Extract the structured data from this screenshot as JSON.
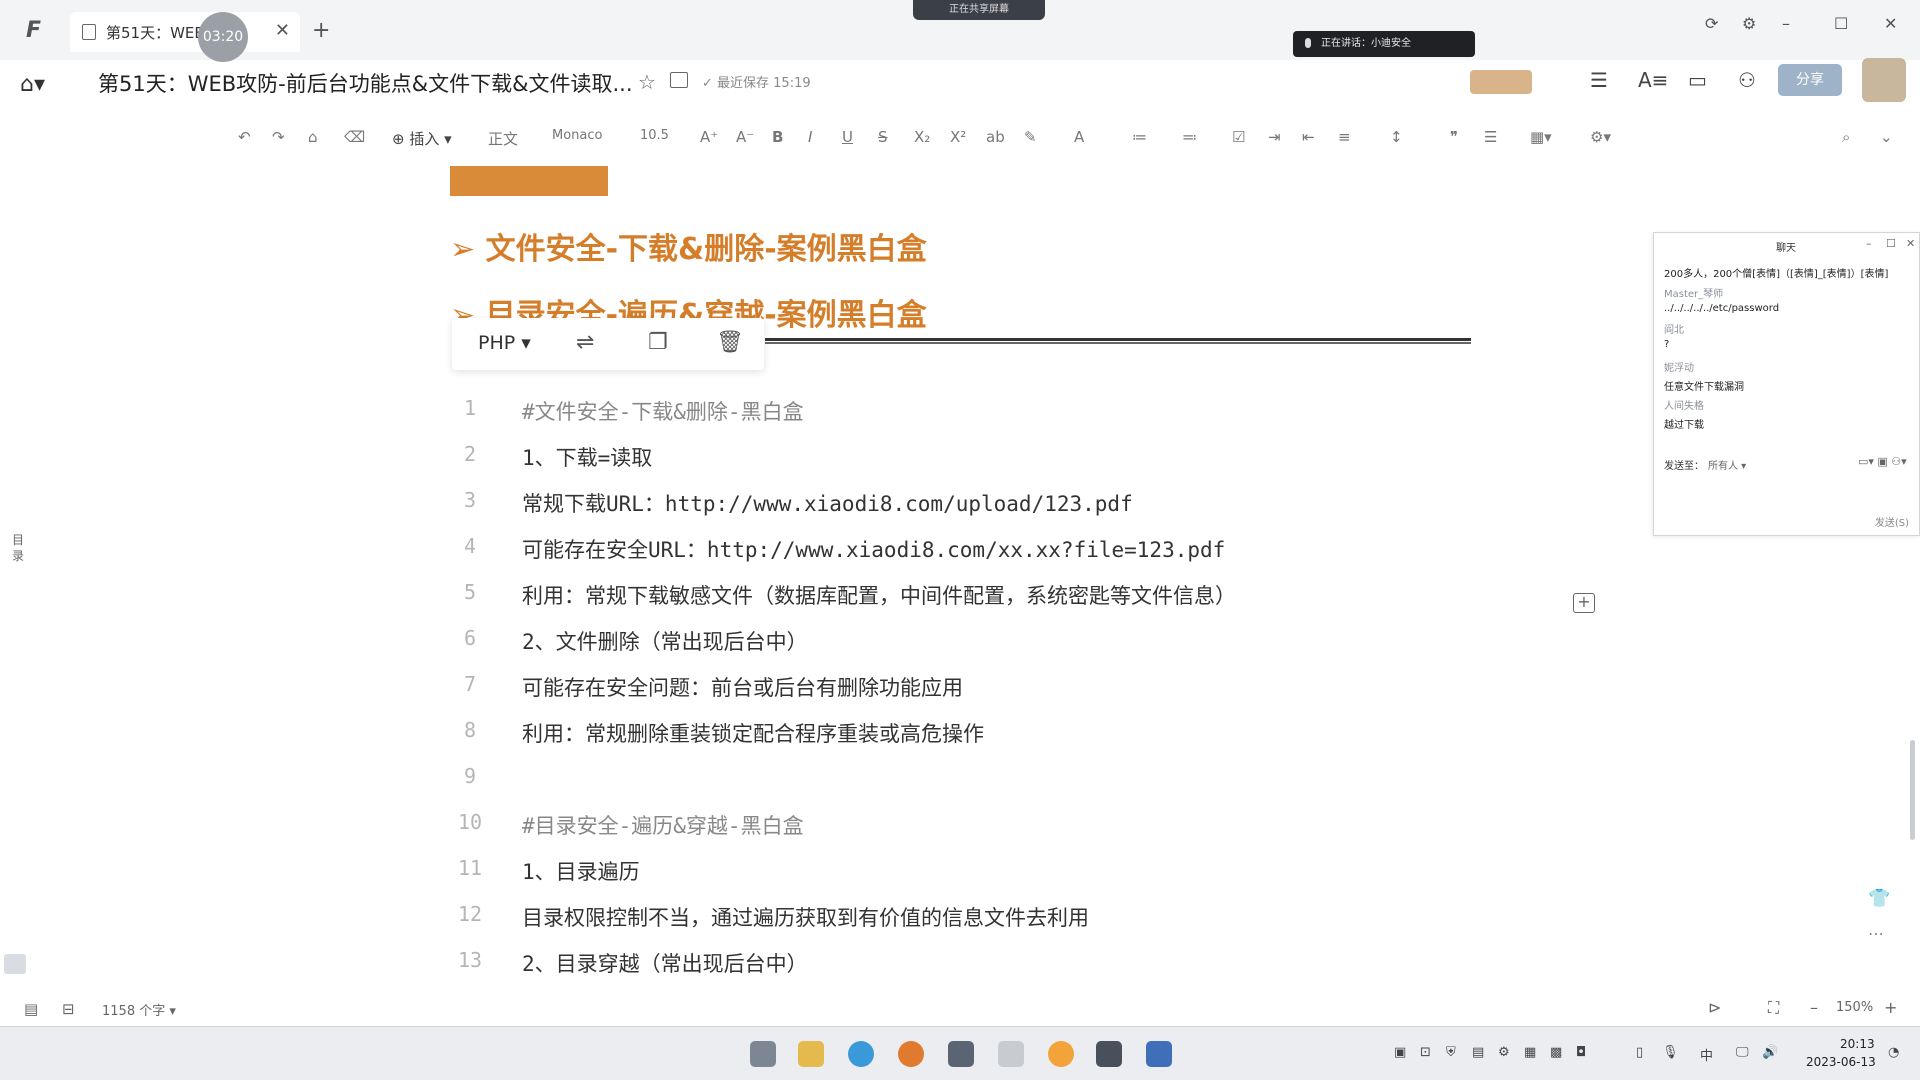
{
  "window": {
    "tab_label": "第51天：WEB",
    "timer": "03:20",
    "recording_badge": "正在共享屏幕",
    "speaking_label": "正在讲话：小迪安全"
  },
  "header": {
    "doc_title": "第51天：WEB攻防-前后台功能点&文件下载&文件读取...",
    "saved_status": "最近保存 15:19",
    "share_label": "分享"
  },
  "toolbar": {
    "insert_label": "插入",
    "style_label": "正文",
    "font_label": "Monaco",
    "size_label": "10.5"
  },
  "editor": {
    "headings": [
      "➢ 文件安全-下载&删除-案例黑白盒",
      "➢ 目录安全-遍历&穿越-案例黑白盒"
    ],
    "code_lang": "PHP",
    "lines": [
      {
        "num": "1",
        "text": "#文件安全-下载&删除-黑白盒"
      },
      {
        "num": "2",
        "text": "1、下载=读取"
      },
      {
        "num": "3",
        "text": "常规下载URL：http://www.xiaodi8.com/upload/123.pdf"
      },
      {
        "num": "4",
        "text": "可能存在安全URL：http://www.xiaodi8.com/xx.xx?file=123.pdf"
      },
      {
        "num": "5",
        "text": "利用：常规下载敏感文件（数据库配置，中间件配置，系统密匙等文件信息）"
      },
      {
        "num": "6",
        "text": "2、文件删除（常出现后台中）"
      },
      {
        "num": "7",
        "text": "可能存在安全问题：前台或后台有删除功能应用"
      },
      {
        "num": "8",
        "text": "利用：常规删除重装锁定配合程序重装或高危操作"
      },
      {
        "num": "9",
        "text": ""
      },
      {
        "num": "10",
        "text": "#目录安全-遍历&穿越-黑白盒"
      },
      {
        "num": "11",
        "text": "1、目录遍历"
      },
      {
        "num": "12",
        "text": "目录权限控制不当，通过遍历获取到有价值的信息文件去利用"
      },
      {
        "num": "13",
        "text": "2、目录穿越（常出现后台中）"
      }
    ],
    "outline_label": "目录"
  },
  "chat": {
    "title": "聊天",
    "messages": [
      {
        "type": "body",
        "text": "200多人，200个僧[表情]（[表情]_[表情]）[表情]"
      },
      {
        "type": "name",
        "text": "Master_琴师"
      },
      {
        "type": "body",
        "text": "../../../../../etc/password"
      },
      {
        "type": "name",
        "text": "阎北"
      },
      {
        "type": "body",
        "text": "?"
      },
      {
        "type": "name",
        "text": "妮浮动"
      },
      {
        "type": "body",
        "text": "任意文件下载漏洞"
      },
      {
        "type": "name",
        "text": "人间失格"
      },
      {
        "type": "body",
        "text": "越过下载"
      }
    ],
    "send_to_label": "发送至：",
    "send_to_value": "所有人",
    "send_button": "发送(S)"
  },
  "status": {
    "word_count": "1158 个字",
    "zoom": "150%"
  },
  "taskbar": {
    "time": "20:13",
    "date": "2023-06-13",
    "ime": "中"
  },
  "colors": {
    "heading_orange": "#d47e2a",
    "accent_block": "#d98b3a",
    "line_number": "#b5b5b5"
  }
}
